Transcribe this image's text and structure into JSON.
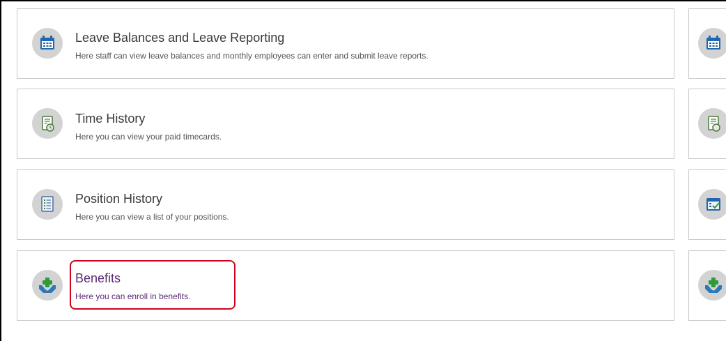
{
  "cards": [
    {
      "title": "Leave Balances and Leave Reporting",
      "description": "Here staff can view leave balances and monthly employees can enter and submit leave reports.",
      "icon": "calendar-icon"
    },
    {
      "title": "Time History",
      "description": "Here you can view your paid timecards.",
      "icon": "timecard-icon"
    },
    {
      "title": "Position History",
      "description": "Here you can view a list of your positions.",
      "icon": "list-document-icon"
    },
    {
      "title": "Benefits",
      "description": "Here you can enroll in benefits.",
      "icon": "benefits-hands-icon",
      "highlighted": true
    }
  ],
  "right_column_icons": [
    "calendar-icon",
    "timecard-icon",
    "calendar-check-icon",
    "benefits-hands-icon"
  ],
  "colors": {
    "icon_background": "#d3d3d3",
    "calendar_blue": "#1f67b1",
    "card_border": "#c9c9c9",
    "benefits_text": "#5b2a72",
    "highlight_border": "#d0021b"
  }
}
